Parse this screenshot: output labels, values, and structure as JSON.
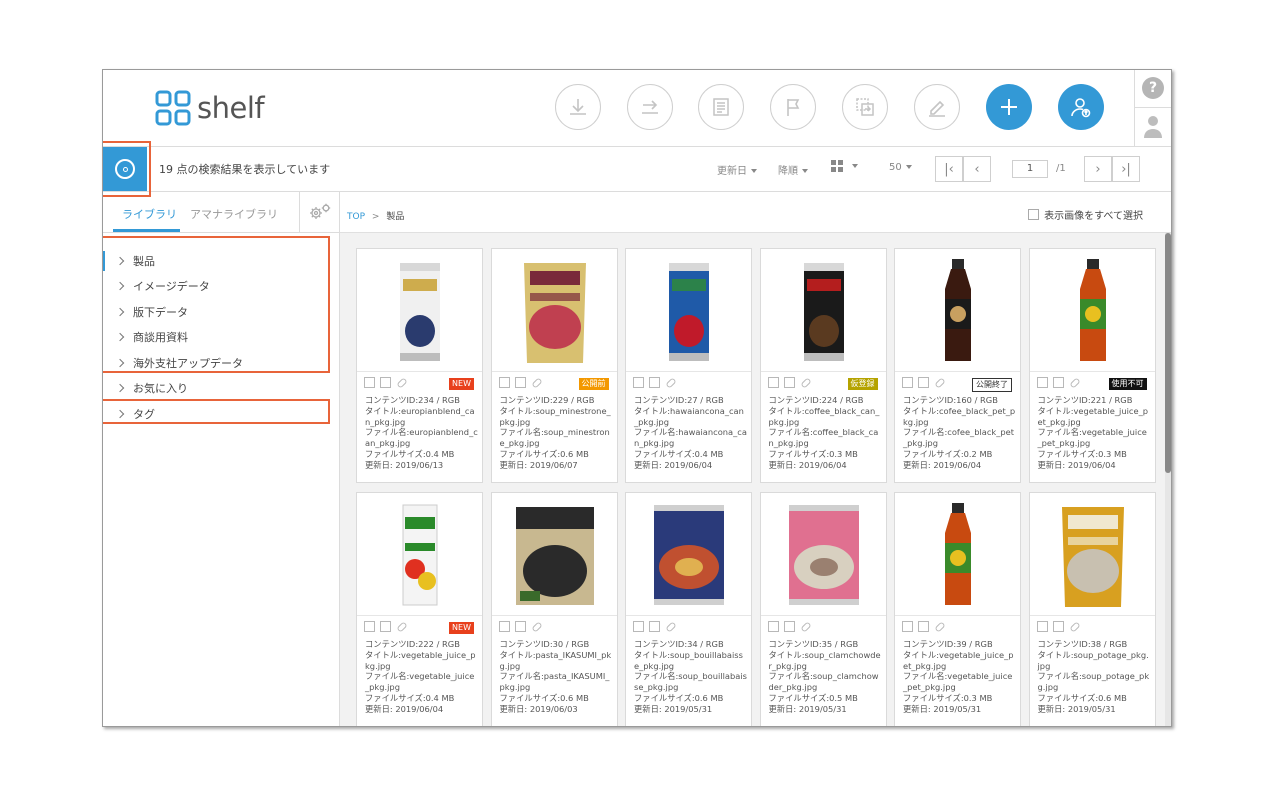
{
  "app": {
    "logo_text": "shelf"
  },
  "header": {
    "buttons": [
      {
        "name": "download-button",
        "icon": "download-icon"
      },
      {
        "name": "share-button",
        "icon": "share-icon"
      },
      {
        "name": "document-button",
        "icon": "document-icon"
      },
      {
        "name": "flag-button",
        "icon": "flag-icon"
      },
      {
        "name": "copy-move-button",
        "icon": "copy-icon"
      },
      {
        "name": "edit-button",
        "icon": "edit-icon"
      },
      {
        "name": "add-button",
        "icon": "plus-icon"
      },
      {
        "name": "upload-user-button",
        "icon": "user-upload-icon"
      }
    ],
    "help_label": "?"
  },
  "bar": {
    "result_text": "19 点の検索結果を表示しています",
    "sort_field": "更新日",
    "sort_order": "降順",
    "view_mode_icon": "grid-icon",
    "per_page": "50",
    "current_page": "1",
    "total_pages": "/1"
  },
  "sidebar": {
    "tabs": [
      {
        "label": "ライブラリ"
      },
      {
        "label": "アマナライブラリ"
      }
    ],
    "items": [
      {
        "label": "製品"
      },
      {
        "label": "イメージデータ"
      },
      {
        "label": "版下データ"
      },
      {
        "label": "商談用資料"
      },
      {
        "label": "海外支社アップデータ"
      },
      {
        "label": "お気に入り"
      },
      {
        "label": "タグ"
      }
    ]
  },
  "main": {
    "breadcrumb": {
      "root": "TOP",
      "separator": ">",
      "current": "製品"
    },
    "select_all_label": "表示画像をすべて選択",
    "cards": [
      {
        "badge": "NEW",
        "badge_style": "new",
        "id": "コンテンツID:234 / RGB",
        "title": "タイトル:europianblend_can_pkg.jpg",
        "file": "ファイル名:europianblend_can_pkg.jpg",
        "size": "ファイルサイズ:0.4 MB",
        "date": "更新日: 2019/06/13",
        "kind": "can",
        "colors": [
          "#f0f0f0",
          "#2a3b6e",
          "#c8a030"
        ]
      },
      {
        "badge": "公開前",
        "badge_style": "orange",
        "id": "コンテンツID:229 / RGB",
        "title": "タイトル:soup_minestrone_pkg.jpg",
        "file": "ファイル名:soup_minestrone_pkg.jpg",
        "size": "ファイルサイズ:0.6 MB",
        "date": "更新日: 2019/06/07",
        "kind": "pouch",
        "colors": [
          "#7a2a3a",
          "#d8c070",
          "#c04050"
        ]
      },
      {
        "badge": "",
        "badge_style": "",
        "id": "コンテンツID:27 / RGB",
        "title": "タイトル:hawaiancona_can_pkg.jpg",
        "file": "ファイル名:hawaiancona_can_pkg.jpg",
        "size": "ファイルサイズ:0.4 MB",
        "date": "更新日: 2019/06/04",
        "kind": "can",
        "colors": [
          "#1f5aa8",
          "#c01a2a",
          "#2f8a3a"
        ]
      },
      {
        "badge": "仮登録",
        "badge_style": "olive",
        "id": "コンテンツID:224 / RGB",
        "title": "タイトル:coffee_black_can_pkg.jpg",
        "file": "ファイル名:coffee_black_can_pkg.jpg",
        "size": "ファイルサイズ:0.3 MB",
        "date": "更新日: 2019/06/04",
        "kind": "can",
        "colors": [
          "#1a1a1a",
          "#5a3a20",
          "#d02020"
        ]
      },
      {
        "badge": "公開終了",
        "badge_style": "outline",
        "id": "コンテンツID:160 / RGB",
        "title": "タイトル:cofee_black_pet_pkg.jpg",
        "file": "ファイル名:cofee_black_pet_pkg.jpg",
        "size": "ファイルサイズ:0.2 MB",
        "date": "更新日: 2019/06/04",
        "kind": "bottle",
        "colors": [
          "#3a1a10",
          "#1a1a1a",
          "#c8a060"
        ]
      },
      {
        "badge": "使用不可",
        "badge_style": "black",
        "id": "コンテンツID:221 / RGB",
        "title": "タイトル:vegetable_juice_pet_pkg.jpg",
        "file": "ファイル名:vegetable_juice_pet_pkg.jpg",
        "size": "ファイルサイズ:0.3 MB",
        "date": "更新日: 2019/06/04",
        "kind": "bottle",
        "colors": [
          "#c84a10",
          "#3a8a2a",
          "#e8c020"
        ]
      },
      {
        "badge": "NEW",
        "badge_style": "new",
        "id": "コンテンツID:222 / RGB",
        "title": "タイトル:vegetable_juice_pkg.jpg",
        "file": "ファイル名:vegetable_juice_pkg.jpg",
        "size": "ファイルサイズ:0.4 MB",
        "date": "更新日: 2019/06/04",
        "kind": "carton",
        "colors": [
          "#f4f4f4",
          "#2a8a2a",
          "#e03020"
        ]
      },
      {
        "badge": "",
        "badge_style": "",
        "id": "コンテンツID:30 / RGB",
        "title": "タイトル:pasta_IKASUMI_pkg.jpg",
        "file": "ファイル名:pasta_IKASUMI_pkg.jpg",
        "size": "ファイルサイズ:0.6 MB",
        "date": "更新日: 2019/06/03",
        "kind": "box",
        "colors": [
          "#2a2a2a",
          "#c8b890",
          "#3a6a2a"
        ]
      },
      {
        "badge": "",
        "badge_style": "",
        "id": "コンテンツID:34 / RGB",
        "title": "タイトル:soup_bouillabaisse_pkg.jpg",
        "file": "ファイル名:soup_bouillabaisse_pkg.jpg",
        "size": "ファイルサイズ:0.6 MB",
        "date": "更新日: 2019/05/31",
        "kind": "tin",
        "colors": [
          "#2a3a7a",
          "#c05030",
          "#e0b050"
        ]
      },
      {
        "badge": "",
        "badge_style": "",
        "id": "コンテンツID:35 / RGB",
        "title": "タイトル:soup_clamchowder_pkg.jpg",
        "file": "ファイル名:soup_clamchowder_pkg.jpg",
        "size": "ファイルサイズ:0.5 MB",
        "date": "更新日: 2019/05/31",
        "kind": "tin",
        "colors": [
          "#e07090",
          "#d8d0c0",
          "#9a8070"
        ]
      },
      {
        "badge": "",
        "badge_style": "",
        "id": "コンテンツID:39 / RGB",
        "title": "タイトル:vegetable_juice_pet_pkg.jpg",
        "file": "ファイル名:vegetable_juice_pet_pkg.jpg",
        "size": "ファイルサイズ:0.3 MB",
        "date": "更新日: 2019/05/31",
        "kind": "bottle",
        "colors": [
          "#c84a10",
          "#3a8a2a",
          "#e8c020"
        ]
      },
      {
        "badge": "",
        "badge_style": "",
        "id": "コンテンツID:38 / RGB",
        "title": "タイトル:soup_potage_pkg.jpg",
        "file": "ファイル名:soup_potage_pkg.jpg",
        "size": "ファイルサイズ:0.6 MB",
        "date": "更新日: 2019/05/31",
        "kind": "pouch",
        "colors": [
          "#f0e8d0",
          "#d8a020",
          "#c8c0b0"
        ]
      }
    ]
  },
  "accent_color": "#3399d6",
  "highlight_color": "#e8643a"
}
